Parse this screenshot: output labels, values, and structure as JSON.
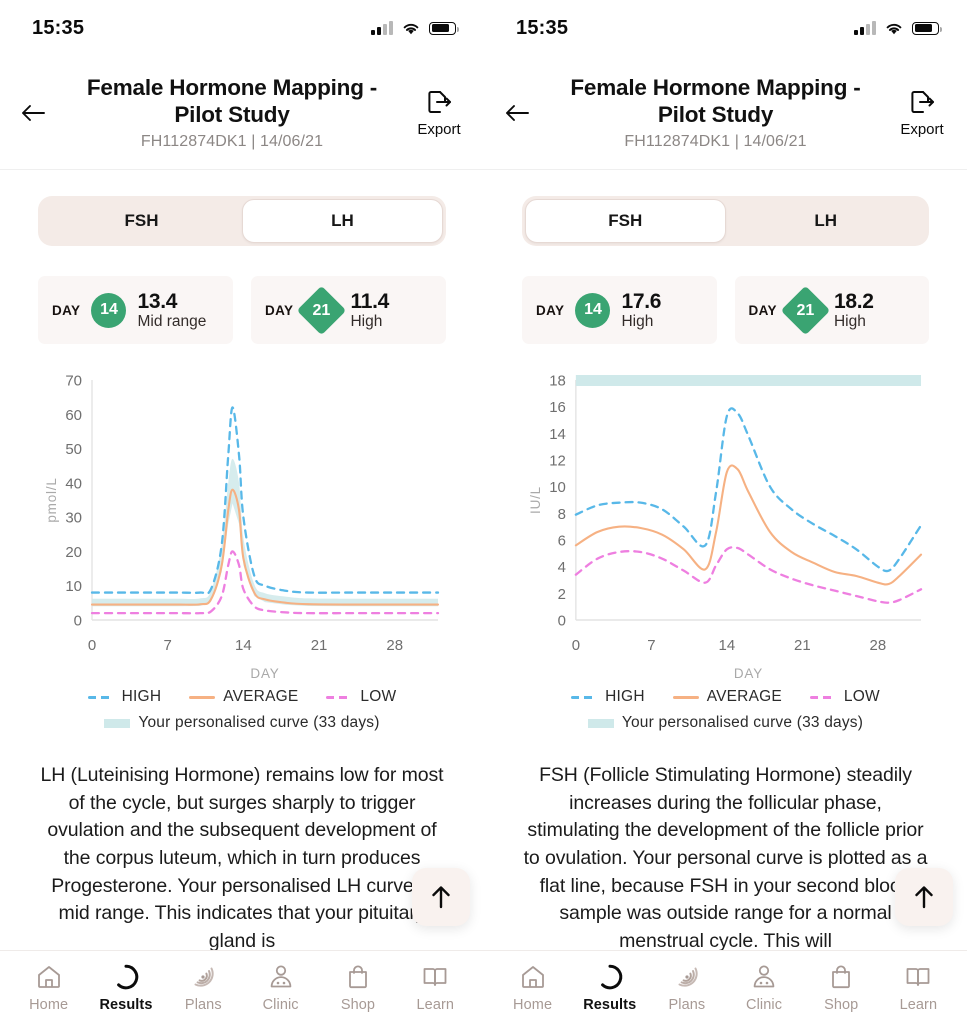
{
  "panels": [
    {
      "id": "lh-panel",
      "statusbar": {
        "time": "15:35",
        "signal_icon": "cellular-signal-icon",
        "wifi_icon": "wifi-icon",
        "battery_icon": "battery-icon"
      },
      "header": {
        "back_icon": "back-arrow-icon",
        "title": "Female Hormone Mapping - Pilot Study",
        "subtitle": "FH112874DK1 | 14/06/21",
        "export_icon": "export-icon",
        "export_label": "Export"
      },
      "tabs": [
        {
          "label": "FSH",
          "active": false
        },
        {
          "label": "LH",
          "active": true
        }
      ],
      "cards": [
        {
          "day_label": "DAY",
          "day": "14",
          "shape": "circle",
          "value": "13.4",
          "state": "Mid range"
        },
        {
          "day_label": "DAY",
          "day": "21",
          "shape": "diamond",
          "value": "11.4",
          "state": "High"
        }
      ],
      "legend": {
        "high": "HIGH",
        "average": "AVERAGE",
        "low": "LOW",
        "personalised": "Your personalised curve (33 days)"
      },
      "description": "LH (Luteinising Hormone) remains low for most of the cycle, but surges sharply to trigger ovulation and the subsequent development of the corpus luteum, which in turn produces Progesterone. Your personalised LH curve is mid range. This indicates that your pituitary gland is",
      "fab_icon": "scroll-to-top-arrow-icon",
      "chart_data": {
        "type": "line",
        "title": "",
        "xlabel": "DAY",
        "ylabel": "pmol/L",
        "xlim": [
          0,
          32
        ],
        "ylim": [
          0,
          70
        ],
        "xticks": [
          "0",
          "7",
          "14",
          "21",
          "28"
        ],
        "yticks": [
          "0",
          "10",
          "20",
          "30",
          "40",
          "50",
          "60",
          "70"
        ],
        "grid": false,
        "legend_position": "below",
        "x": [
          0,
          2,
          4,
          6,
          8,
          10,
          11,
          12,
          12.6,
          13,
          13.6,
          14,
          15,
          16,
          18,
          20,
          24,
          28,
          32
        ],
        "series": [
          {
            "name": "HIGH",
            "style": "dashed",
            "color": "#58b8e8",
            "values": [
              8,
              8,
              8,
              8,
              8,
              8,
              9,
              22,
              48,
              62,
              48,
              30,
              13,
              10,
              8.5,
              8,
              8,
              8,
              8
            ]
          },
          {
            "name": "AVERAGE",
            "style": "solid",
            "color": "#f6b183",
            "values": [
              4.5,
              4.5,
              4.5,
              4.5,
              4.5,
              4.6,
              6,
              16,
              32,
              38,
              32,
              18,
              8,
              6,
              5,
              4.6,
              4.5,
              4.5,
              4.5
            ]
          },
          {
            "name": "LOW",
            "style": "dashed",
            "color": "#ee7fe0",
            "values": [
              2,
              2,
              2,
              2,
              2,
              2,
              2.5,
              7,
              16,
              20,
              16,
              9,
              4,
              2.8,
              2.2,
              2,
              2,
              2,
              2
            ]
          },
          {
            "name": "Your personalised curve (33 days)",
            "style": "band",
            "color": "#cfe9ea",
            "band_low": [
              4.0,
              4.0,
              4.0,
              4.0,
              4.0,
              4.1,
              5.2,
              14,
              28,
              34,
              28,
              16,
              7,
              5.2,
              4.4,
              4.1,
              4.0,
              4.0,
              4.0
            ],
            "band_high": [
              6.2,
              6.2,
              6.2,
              6.2,
              6.2,
              6.3,
              8.4,
              22,
              40,
              47,
              40,
              24,
              10.5,
              7.8,
              6.8,
              6.3,
              6.2,
              6.2,
              6.2
            ]
          }
        ]
      }
    },
    {
      "id": "fsh-panel",
      "statusbar": {
        "time": "15:35",
        "signal_icon": "cellular-signal-icon",
        "wifi_icon": "wifi-icon",
        "battery_icon": "battery-icon"
      },
      "header": {
        "back_icon": "back-arrow-icon",
        "title": "Female Hormone Mapping - Pilot Study",
        "subtitle": "FH112874DK1 | 14/06/21",
        "export_icon": "export-icon",
        "export_label": "Export"
      },
      "tabs": [
        {
          "label": "FSH",
          "active": true
        },
        {
          "label": "LH",
          "active": false
        }
      ],
      "cards": [
        {
          "day_label": "DAY",
          "day": "14",
          "shape": "circle",
          "value": "17.6",
          "state": "High"
        },
        {
          "day_label": "DAY",
          "day": "21",
          "shape": "diamond",
          "value": "18.2",
          "state": "High"
        }
      ],
      "legend": {
        "high": "HIGH",
        "average": "AVERAGE",
        "low": "LOW",
        "personalised": "Your personalised curve (33 days)"
      },
      "description": "FSH (Follicle Stimulating Hormone) steadily increases during the follicular phase, stimulating the development of the follicle prior to ovulation. Your personal curve is plotted as a flat line, because FSH in your second blood sample was outside range for a normal menstrual cycle. This will",
      "fab_icon": "scroll-to-top-arrow-icon",
      "chart_data": {
        "type": "line",
        "title": "",
        "xlabel": "DAY",
        "ylabel": "IU/L",
        "xlim": [
          0,
          32
        ],
        "ylim": [
          0,
          18
        ],
        "xticks": [
          "0",
          "7",
          "14",
          "21",
          "28"
        ],
        "yticks": [
          "0",
          "2",
          "4",
          "6",
          "8",
          "10",
          "12",
          "14",
          "16",
          "18"
        ],
        "grid": false,
        "legend_position": "below",
        "x": [
          0,
          2,
          4,
          6,
          8,
          10,
          12,
          13,
          14,
          15,
          16,
          18,
          20,
          22,
          24,
          26,
          28,
          29,
          30,
          32
        ],
        "series": [
          {
            "name": "HIGH",
            "style": "dashed",
            "color": "#58b8e8",
            "values": [
              7.9,
              8.6,
              8.8,
              8.8,
              8.3,
              7.0,
              5.6,
              9.6,
              15.3,
              15.5,
              13.8,
              10.0,
              8.3,
              7.2,
              6.3,
              5.3,
              4.0,
              3.7,
              4.6,
              7.1
            ]
          },
          {
            "name": "AVERAGE",
            "style": "solid",
            "color": "#f6b183",
            "values": [
              5.6,
              6.6,
              7.0,
              6.9,
              6.4,
              5.3,
              3.8,
              6.6,
              11.1,
              11.3,
              9.6,
              6.6,
              5.1,
              4.3,
              3.6,
              3.3,
              2.8,
              2.7,
              3.3,
              4.9
            ]
          },
          {
            "name": "LOW",
            "style": "dashed",
            "color": "#ee7fe0",
            "values": [
              3.4,
              4.6,
              5.1,
              5.1,
              4.6,
              3.7,
              2.8,
              4.1,
              5.3,
              5.4,
              4.9,
              3.8,
              3.1,
              2.6,
              2.2,
              1.8,
              1.4,
              1.3,
              1.5,
              2.3
            ]
          },
          {
            "name": "Your personalised curve (33 days)",
            "style": "flat-band",
            "color": "#cfe9ea",
            "flat_value": 18
          }
        ]
      }
    }
  ],
  "tabbar": {
    "items": [
      {
        "label": "Home",
        "icon": "home-icon",
        "active": false
      },
      {
        "label": "Results",
        "icon": "results-ring-icon",
        "active": true
      },
      {
        "label": "Plans",
        "icon": "plans-spiral-icon",
        "active": false
      },
      {
        "label": "Clinic",
        "icon": "clinic-doctor-icon",
        "active": false
      },
      {
        "label": "Shop",
        "icon": "shop-bag-icon",
        "active": false
      },
      {
        "label": "Learn",
        "icon": "learn-book-icon",
        "active": false
      }
    ]
  },
  "colors": {
    "high": "#58b8e8",
    "average": "#f6b183",
    "low": "#ee7fe0",
    "band": "#cfe9ea",
    "badge_green": "#3aa472",
    "tab_bg": "#f4ebe7",
    "card_bg": "#faf6f5"
  }
}
